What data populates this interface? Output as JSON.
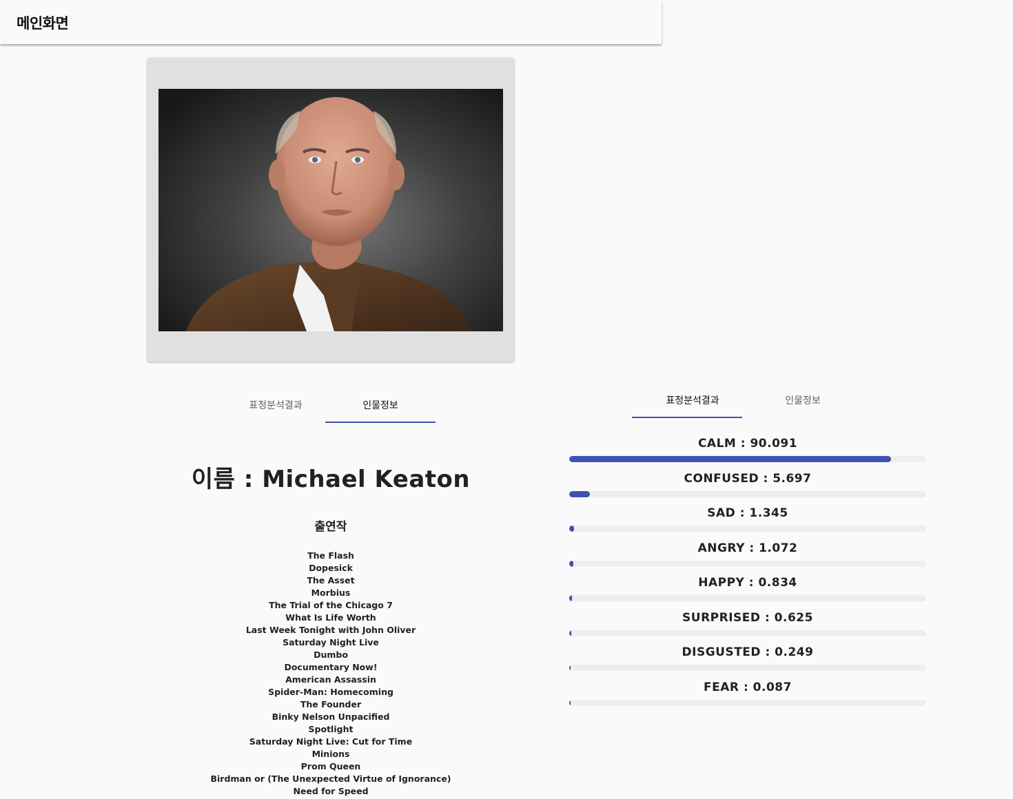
{
  "appbar": {
    "title": "메인화면"
  },
  "photo": {
    "alt": "Michael Keaton portrait photo"
  },
  "left_tabs": [
    {
      "label": "표정분석결과",
      "active": false
    },
    {
      "label": "인물정보",
      "active": true
    }
  ],
  "right_tabs": [
    {
      "label": "표정분석결과",
      "active": true
    },
    {
      "label": "인물정보",
      "active": false
    }
  ],
  "person": {
    "name_line": "이름 : Michael Keaton",
    "films_heading": "출연작",
    "films": [
      "The Flash",
      "Dopesick",
      "The Asset",
      "Morbius",
      "The Trial of the Chicago 7",
      "What Is Life Worth",
      "Last Week Tonight with John Oliver",
      "Saturday Night Live",
      "Dumbo",
      "Documentary Now!",
      "American Assassin",
      "Spider-Man: Homecoming",
      "The Founder",
      "Binky Nelson Unpacified",
      "Spotlight",
      "Saturday Night Live: Cut for Time",
      "Minions",
      "Prom Queen",
      "Birdman or (The Unexpected Virtue of Ignorance)",
      "Need for Speed"
    ]
  },
  "emotions": [
    {
      "label": "CALM : 90.091",
      "percent": 90.091
    },
    {
      "label": "CONFUSED : 5.697",
      "percent": 5.697
    },
    {
      "label": "SAD : 1.345",
      "percent": 1.345
    },
    {
      "label": "ANGRY : 1.072",
      "percent": 1.072
    },
    {
      "label": "HAPPY : 0.834",
      "percent": 0.834
    },
    {
      "label": "SURPRISED : 0.625",
      "percent": 0.625
    },
    {
      "label": "DISGUSTED : 0.249",
      "percent": 0.249
    },
    {
      "label": "FEAR : 0.087",
      "percent": 0.087
    }
  ],
  "colors": {
    "accent": "#3f51b5",
    "track": "#eeeeee",
    "card": "#e0e0e0",
    "background": "#fafafa"
  }
}
